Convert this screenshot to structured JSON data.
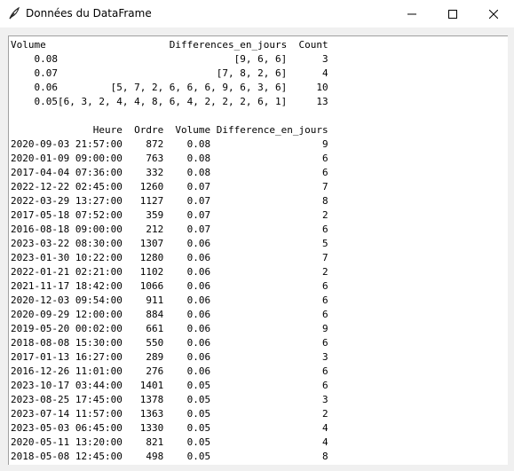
{
  "window": {
    "title": "Données du DataFrame",
    "icon": "feather-icon",
    "controls": [
      "minimize-icon",
      "maximize-icon",
      "close-icon"
    ]
  },
  "summary_table": {
    "columns": [
      "Volume",
      "Differences_en_jours",
      "Count"
    ],
    "rows": [
      {
        "Volume": "0.08",
        "Differences_en_jours": "[9, 6, 6]",
        "Count": "3"
      },
      {
        "Volume": "0.07",
        "Differences_en_jours": "[7, 8, 2, 6]",
        "Count": "4"
      },
      {
        "Volume": "0.06",
        "Differences_en_jours": "[5, 7, 2, 6, 6, 6, 9, 6, 3, 6]",
        "Count": "10"
      },
      {
        "Volume": "0.05",
        "Differences_en_jours": "[6, 3, 2, 4, 4, 8, 6, 4, 2, 2, 2, 6, 1]",
        "Count": "13"
      }
    ]
  },
  "detail_table": {
    "columns": [
      "Heure",
      "Ordre",
      "Volume",
      "Difference_en_jours"
    ],
    "rows": [
      {
        "Heure": "2020-09-03 21:57:00",
        "Ordre": "872",
        "Volume": "0.08",
        "Difference_en_jours": "9"
      },
      {
        "Heure": "2020-01-09 09:00:00",
        "Ordre": "763",
        "Volume": "0.08",
        "Difference_en_jours": "6"
      },
      {
        "Heure": "2017-04-04 07:36:00",
        "Ordre": "332",
        "Volume": "0.08",
        "Difference_en_jours": "6"
      },
      {
        "Heure": "2022-12-22 02:45:00",
        "Ordre": "1260",
        "Volume": "0.07",
        "Difference_en_jours": "7"
      },
      {
        "Heure": "2022-03-29 13:27:00",
        "Ordre": "1127",
        "Volume": "0.07",
        "Difference_en_jours": "8"
      },
      {
        "Heure": "2017-05-18 07:52:00",
        "Ordre": "359",
        "Volume": "0.07",
        "Difference_en_jours": "2"
      },
      {
        "Heure": "2016-08-18 09:00:00",
        "Ordre": "212",
        "Volume": "0.07",
        "Difference_en_jours": "6"
      },
      {
        "Heure": "2023-03-22 08:30:00",
        "Ordre": "1307",
        "Volume": "0.06",
        "Difference_en_jours": "5"
      },
      {
        "Heure": "2023-01-30 10:22:00",
        "Ordre": "1280",
        "Volume": "0.06",
        "Difference_en_jours": "7"
      },
      {
        "Heure": "2022-01-21 02:21:00",
        "Ordre": "1102",
        "Volume": "0.06",
        "Difference_en_jours": "2"
      },
      {
        "Heure": "2021-11-17 18:42:00",
        "Ordre": "1066",
        "Volume": "0.06",
        "Difference_en_jours": "6"
      },
      {
        "Heure": "2020-12-03 09:54:00",
        "Ordre": "911",
        "Volume": "0.06",
        "Difference_en_jours": "6"
      },
      {
        "Heure": "2020-09-29 12:00:00",
        "Ordre": "884",
        "Volume": "0.06",
        "Difference_en_jours": "6"
      },
      {
        "Heure": "2019-05-20 00:02:00",
        "Ordre": "661",
        "Volume": "0.06",
        "Difference_en_jours": "9"
      },
      {
        "Heure": "2018-08-08 15:30:00",
        "Ordre": "550",
        "Volume": "0.06",
        "Difference_en_jours": "6"
      },
      {
        "Heure": "2017-01-13 16:27:00",
        "Ordre": "289",
        "Volume": "0.06",
        "Difference_en_jours": "3"
      },
      {
        "Heure": "2016-12-26 11:01:00",
        "Ordre": "276",
        "Volume": "0.06",
        "Difference_en_jours": "6"
      },
      {
        "Heure": "2023-10-17 03:44:00",
        "Ordre": "1401",
        "Volume": "0.05",
        "Difference_en_jours": "6"
      },
      {
        "Heure": "2023-08-25 17:45:00",
        "Ordre": "1378",
        "Volume": "0.05",
        "Difference_en_jours": "3"
      },
      {
        "Heure": "2023-07-14 11:57:00",
        "Ordre": "1363",
        "Volume": "0.05",
        "Difference_en_jours": "2"
      },
      {
        "Heure": "2023-05-03 06:45:00",
        "Ordre": "1330",
        "Volume": "0.05",
        "Difference_en_jours": "4"
      },
      {
        "Heure": "2020-05-11 13:20:00",
        "Ordre": "821",
        "Volume": "0.05",
        "Difference_en_jours": "4"
      },
      {
        "Heure": "2018-05-08 12:45:00",
        "Ordre": "498",
        "Volume": "0.05",
        "Difference_en_jours": "8"
      }
    ]
  }
}
